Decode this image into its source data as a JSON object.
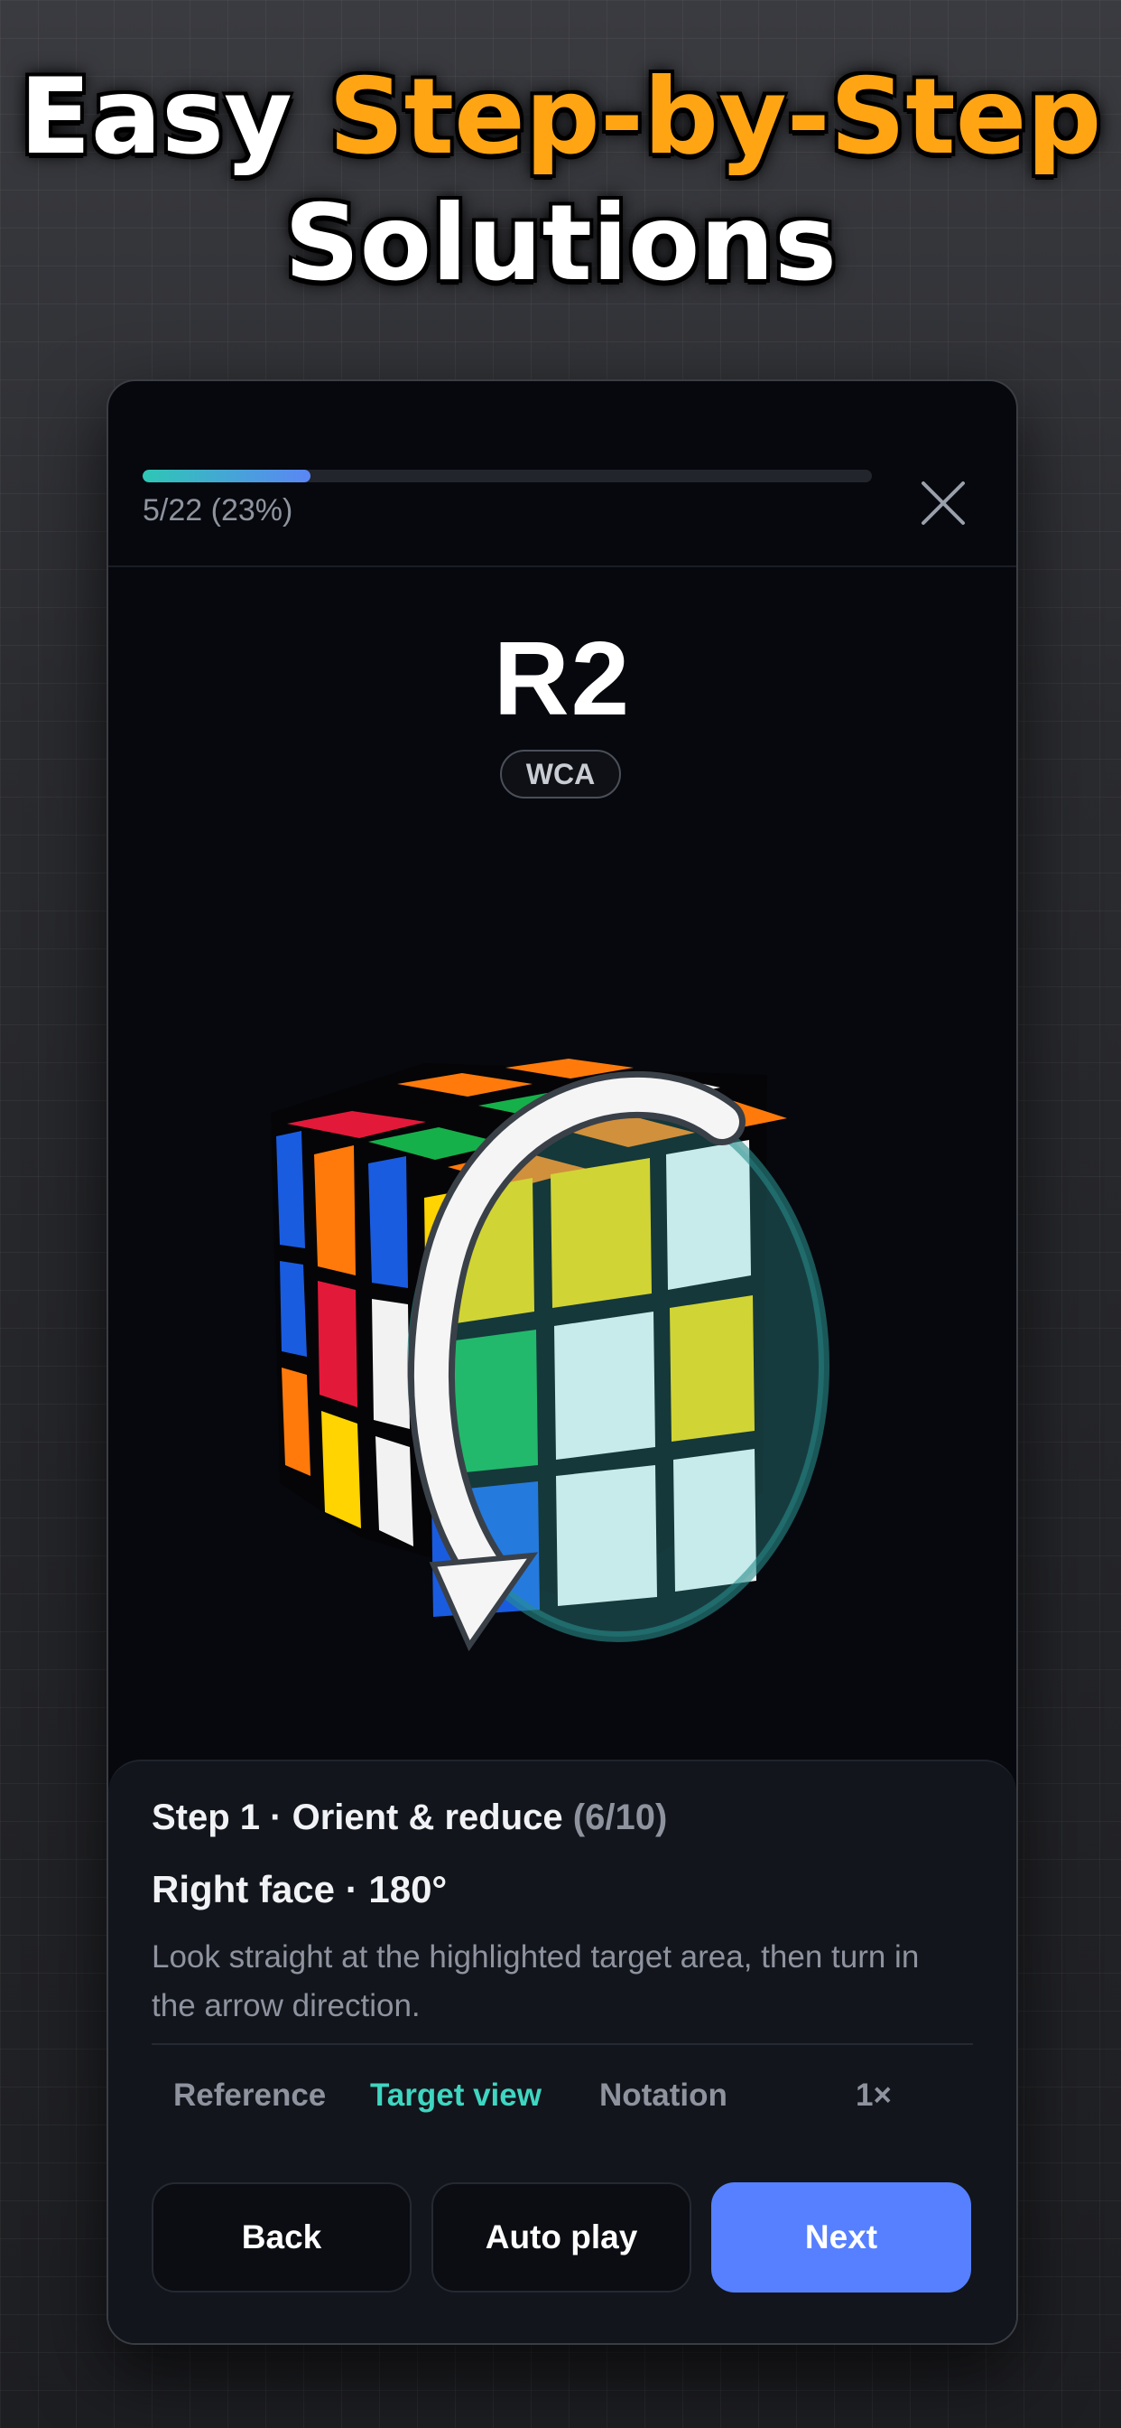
{
  "promo": {
    "headline_word1": "Easy",
    "headline_accent": "Step-by-Step",
    "headline_line2": "Solutions"
  },
  "progress": {
    "label": "5/22 (23%)",
    "current": 5,
    "total": 22,
    "percent": 23
  },
  "move": {
    "notation": "R2",
    "badge": "WCA"
  },
  "panel": {
    "step_title": "Step 1 · Orient & reduce",
    "step_count": "(6/10)",
    "step_subtitle": "Right face · 180°",
    "description": "Look straight at the highlighted target area, then turn in the arrow direction."
  },
  "tabs": [
    {
      "label": "Reference",
      "active": false
    },
    {
      "label": "Target view",
      "active": true
    },
    {
      "label": "Notation",
      "active": false
    },
    {
      "label": "1×",
      "active": false
    }
  ],
  "buttons": {
    "back": "Back",
    "autoplay": "Auto play",
    "next": "Next"
  },
  "colors": {
    "accent_orange": "#ffa514",
    "primary_blue": "#5680ff",
    "active_tab_teal": "#3fd6c1",
    "progress_start": "#2ec7b5",
    "progress_end": "#5b86f5",
    "cube_white": "#f2f2f2",
    "cube_yellow": "#ffd400",
    "cube_green": "#16b04a",
    "cube_blue": "#1a5ce0",
    "cube_red": "#e3193a",
    "cube_orange": "#ff7a0a"
  },
  "icons": {
    "close": "close-icon",
    "rotation_arrow": "rotate-arrow-icon"
  }
}
